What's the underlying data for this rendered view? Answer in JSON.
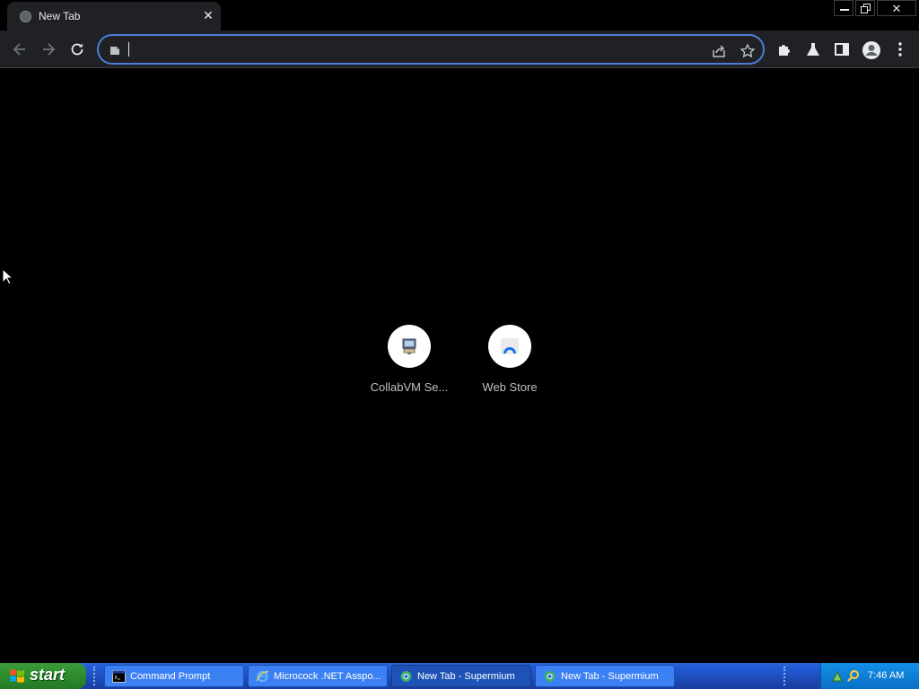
{
  "browser": {
    "tab": {
      "title": "New Tab",
      "close_glyph": "✕"
    },
    "window_controls": {
      "close_glyph": "✕"
    },
    "omnibox": {
      "value": "",
      "placeholder": ""
    },
    "colors": {
      "accent": "#4d7dd8",
      "toolbar": "#202124",
      "page_background": "#000000"
    }
  },
  "new_tab": {
    "shortcuts": [
      {
        "label": "CollabVM Se...",
        "icon": "collabvm-icon"
      },
      {
        "label": "Web Store",
        "icon": "web-store-icon"
      }
    ]
  },
  "taskbar": {
    "start_label": "start",
    "tasks": [
      {
        "label": "Command Prompt",
        "icon": "command-prompt-icon",
        "active": false
      },
      {
        "label": "Microcock .NET Asspo...",
        "icon": "internet-explorer-icon",
        "active": false
      },
      {
        "label": "New Tab - Supermium",
        "icon": "supermium-icon",
        "active": true
      },
      {
        "label": "New Tab - Supermium",
        "icon": "supermium-icon",
        "active": false
      }
    ],
    "clock": "7:46 AM"
  }
}
